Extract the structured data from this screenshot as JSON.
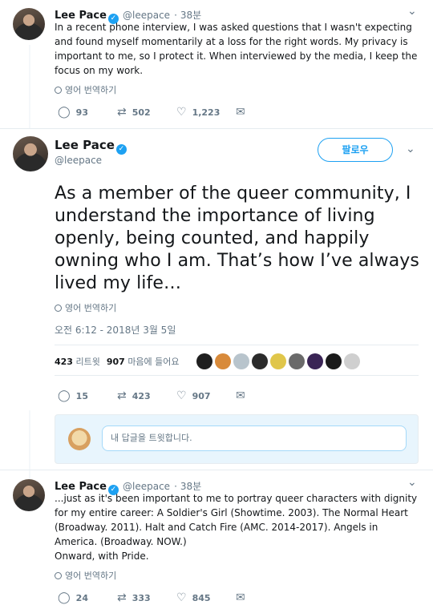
{
  "tweet1": {
    "name": "Lee Pace",
    "handle": "@leepace",
    "time": "38분",
    "text": "In a recent phone interview, I was asked questions that I wasn't expecting and found myself momentarily at a loss for the right words. My privacy is important to me, so I protect it. When interviewed by the media, I keep the focus on my work.",
    "translate": "영어 번역하기",
    "replies": "93",
    "retweets": "502",
    "likes": "1,223"
  },
  "tweet2": {
    "name": "Lee Pace",
    "handle": "@leepace",
    "follow_label": "팔로우",
    "text": "As a member of the queer community, I understand the importance of living openly, being counted, and happily owning who I am. That’s how I’ve always lived my life…",
    "translate": "영어 번역하기",
    "timestamp": "오전 6:12 - 2018년 3월 5일",
    "retweet_count": "423",
    "retweet_label": "리트윗",
    "like_count": "907",
    "like_label": "마음에 들어요",
    "replies": "15",
    "retweets": "423",
    "likes": "907"
  },
  "reply_box": {
    "placeholder": "내 답글을 트윗합니다."
  },
  "tweet3": {
    "name": "Lee Pace",
    "handle": "@leepace",
    "time": "38분",
    "text": "...just as it's been important to me to portray queer characters with dignity for my entire career: A Soldier's Girl (Showtime. 2003). The Normal Heart (Broadway. 2011). Halt and Catch Fire (AMC. 2014-2017). Angels in America. (Broadway. NOW.)\nOnward, with Pride.",
    "translate": "영어 번역하기",
    "replies": "24",
    "retweets": "333",
    "likes": "845"
  },
  "icons": {
    "reply": "reply-icon",
    "retweet": "retweet-icon",
    "like": "heart-icon",
    "dm": "envelope-icon",
    "verified": "verified-badge-icon",
    "globe": "globe-icon",
    "chevron": "chevron-down-icon"
  },
  "colors": {
    "accent": "#1da1f2",
    "muted": "#657786",
    "thread_line": "#f5f8fa"
  },
  "liker_avatar_colors": [
    "#1f1f1f",
    "#d88a3a",
    "#b8c4cc",
    "#2b2b2b",
    "#e0c64a",
    "#6a6a6a",
    "#3a2455",
    "#1a1a1a",
    "#cfcfcf"
  ]
}
